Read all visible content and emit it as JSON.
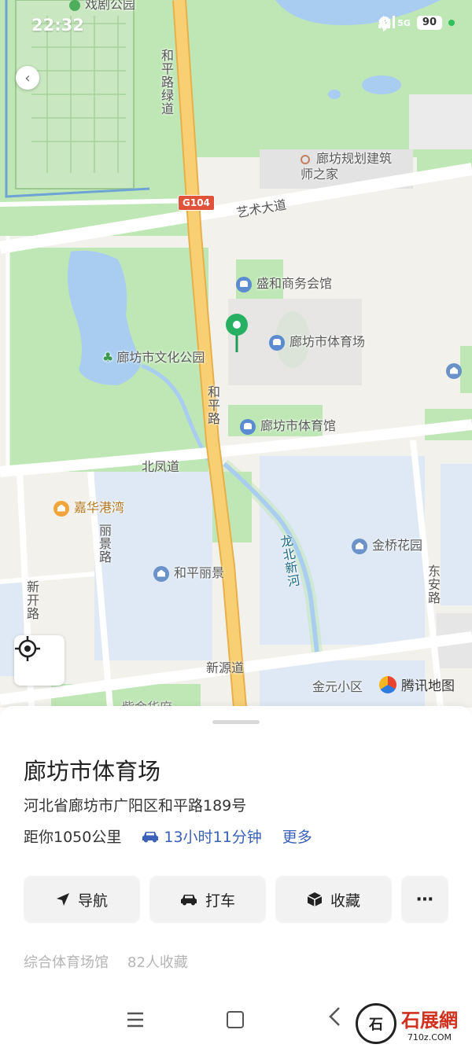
{
  "status_bar": {
    "time": "22:32",
    "signal_1": "5G",
    "signal_2": "5G",
    "battery": "90"
  },
  "map": {
    "labels": {
      "top_park": "戏剧公园",
      "heping_green_road": "和平路绿道",
      "planning_house": "廊坊规划建筑师之家",
      "g104": "G104",
      "art_avenue": "艺术大道",
      "shenghe": "盛和商务会馆",
      "stadium": "廊坊市体育场",
      "culture_park": "廊坊市文化公园",
      "heping_road": "和平路",
      "gymnasium": "廊坊市体育馆",
      "beifeng_road": "北凤道",
      "jiahua": "嘉华港湾",
      "lijing_road": "丽景路",
      "jinqiao": "金桥花园",
      "heping_lijing": "和平丽景",
      "longbei_river": "龙北新河",
      "xinkai_road": "新开路",
      "dongan_road": "东安路",
      "xinyuan_road": "新源道",
      "jinyuan": "金元小区",
      "bottom_partial": "紫金华府"
    },
    "provider": "腾讯地图",
    "colors": {
      "park": "#b8e6b0",
      "water": "#a8cdf0",
      "highway": "#f7c96a",
      "block": "#e6e6e6"
    }
  },
  "place": {
    "title": "廊坊市体育场",
    "address": "河北省廊坊市广阳区和平路189号",
    "distance": "距你1050公里",
    "drive_time": "13小时11分钟",
    "more": "更多",
    "category": "综合体育场馆",
    "favorites": "82人收藏"
  },
  "actions": {
    "navigate": "导航",
    "taxi": "打车",
    "favorite": "收藏",
    "more_icon": "⋯"
  },
  "watermark": {
    "brand_text": "石展網",
    "brand_url": "710z.COM"
  }
}
